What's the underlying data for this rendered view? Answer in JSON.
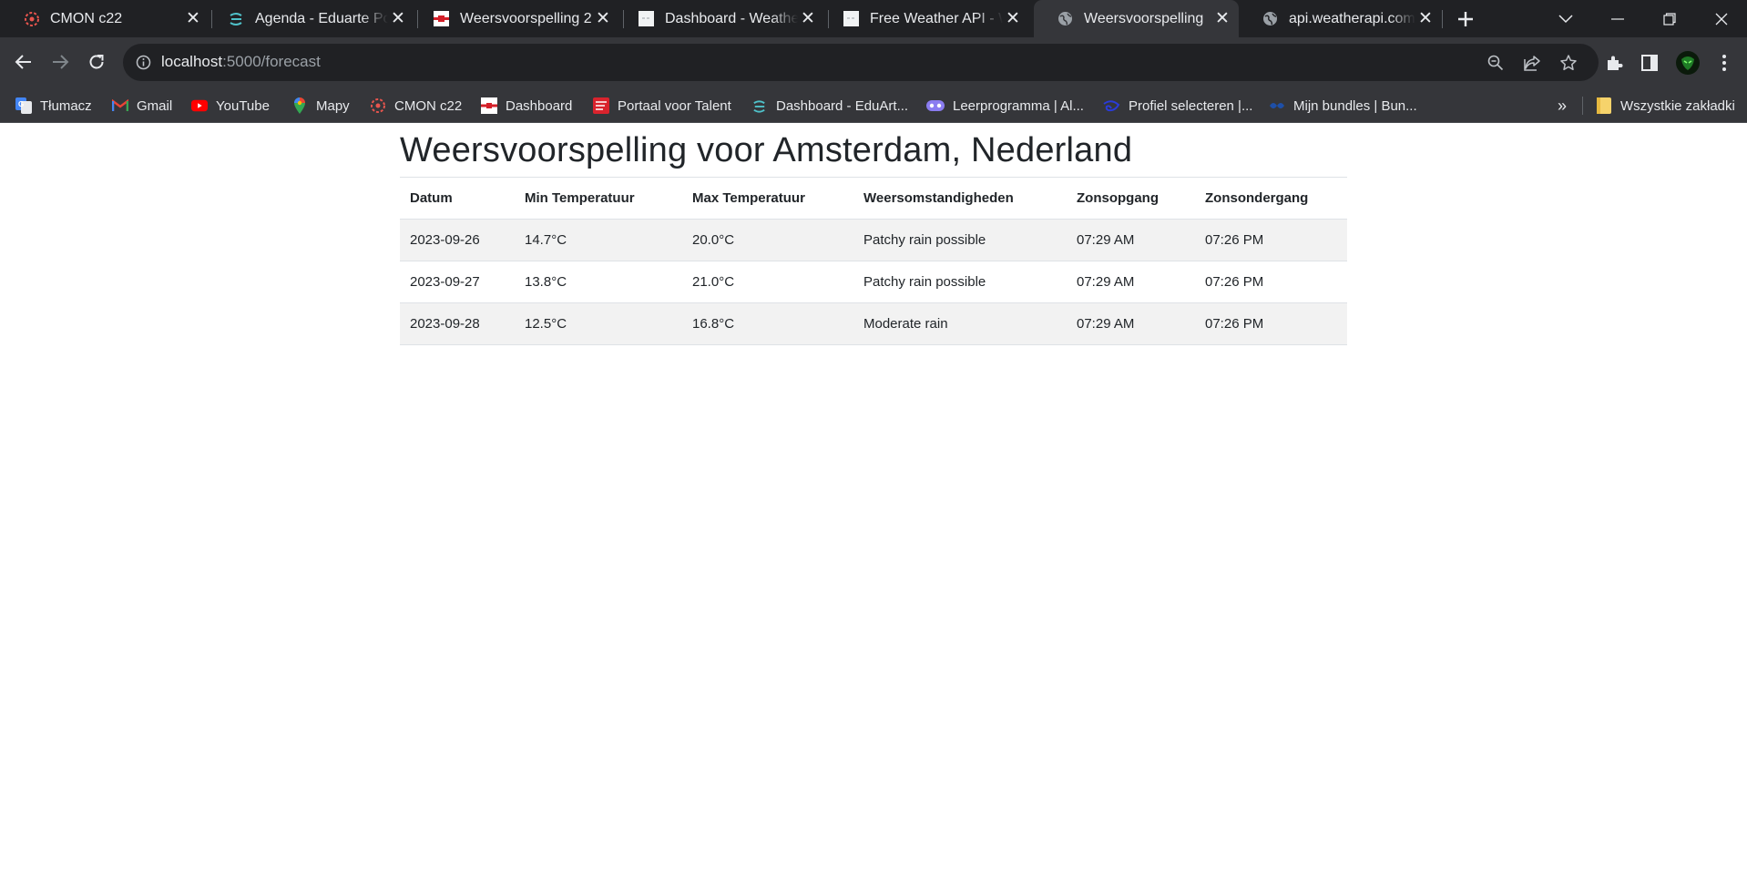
{
  "browser": {
    "tabs": [
      {
        "title": "CMON c22",
        "icon": "cmon-icon"
      },
      {
        "title": "Agenda - Eduarte Por",
        "icon": "eduarte-icon"
      },
      {
        "title": "Weersvoorspelling 2",
        "icon": "flag-icon"
      },
      {
        "title": "Dashboard - Weather",
        "icon": "page-icon"
      },
      {
        "title": "Free Weather API - W",
        "icon": "page-icon"
      },
      {
        "title": "Weersvoorspelling",
        "icon": "globe-icon",
        "active": true
      },
      {
        "title": "api.weatherapi.com/v",
        "icon": "globe-icon"
      }
    ],
    "address_bar": {
      "host": "localhost",
      "path": ":5000/forecast"
    },
    "bookmarks": [
      {
        "label": "Tłumacz",
        "icon": "translate-icon"
      },
      {
        "label": "Gmail",
        "icon": "gmail-icon"
      },
      {
        "label": "YouTube",
        "icon": "youtube-icon"
      },
      {
        "label": "Mapy",
        "icon": "maps-icon"
      },
      {
        "label": "CMON c22",
        "icon": "cmon-icon"
      },
      {
        "label": "Dashboard",
        "icon": "flag-icon"
      },
      {
        "label": "Portaal voor Talent",
        "icon": "portaal-icon"
      },
      {
        "label": "Dashboard - EduArt...",
        "icon": "eduarte-icon"
      },
      {
        "label": "Leerprogramma | Al...",
        "icon": "gamepad-icon"
      },
      {
        "label": "Profiel selecteren |...",
        "icon": "disney-icon"
      },
      {
        "label": "Mijn bundles | Bun...",
        "icon": "bundle-icon"
      }
    ],
    "bookmarks_overflow": "»",
    "all_bookmarks_label": "Wszystkie zakładki"
  },
  "page": {
    "heading": "Weersvoorspelling voor Amsterdam, Nederland",
    "table": {
      "headers": [
        "Datum",
        "Min Temperatuur",
        "Max Temperatuur",
        "Weersomstandigheden",
        "Zonsopgang",
        "Zonsondergang"
      ],
      "rows": [
        [
          "2023-09-26",
          "14.7°C",
          "20.0°C",
          "Patchy rain possible",
          "07:29 AM",
          "07:26 PM"
        ],
        [
          "2023-09-27",
          "13.8°C",
          "21.0°C",
          "Patchy rain possible",
          "07:29 AM",
          "07:26 PM"
        ],
        [
          "2023-09-28",
          "12.5°C",
          "16.8°C",
          "Moderate rain",
          "07:29 AM",
          "07:26 PM"
        ]
      ]
    }
  }
}
